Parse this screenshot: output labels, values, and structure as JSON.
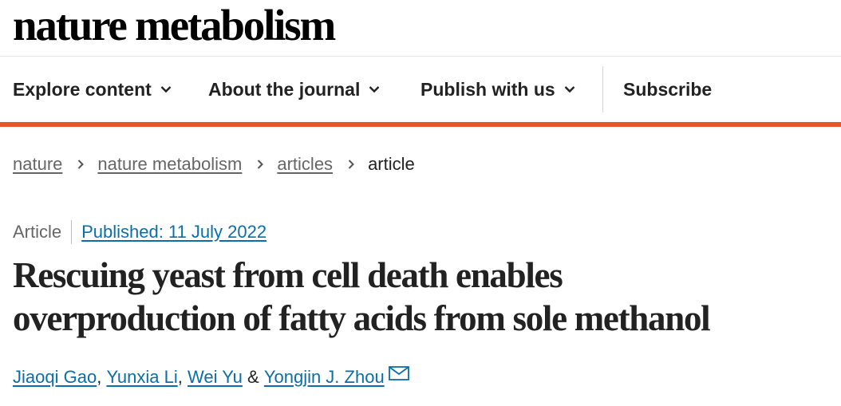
{
  "header": {
    "logo_text": "nature metabolism"
  },
  "nav": {
    "items": [
      {
        "label": "Explore content",
        "has_dropdown": true
      },
      {
        "label": "About the journal",
        "has_dropdown": true
      },
      {
        "label": "Publish with us",
        "has_dropdown": true
      },
      {
        "label": "Subscribe",
        "has_dropdown": false
      }
    ],
    "accent_color": "#e8552b"
  },
  "breadcrumb": {
    "items": [
      "nature",
      "nature metabolism",
      "articles"
    ],
    "current": "article"
  },
  "article": {
    "type": "Article",
    "published": "Published: 11 July 2022",
    "title_line1": "Rescuing yeast from cell death enables",
    "title_line2": "overproduction of fatty acids from sole methanol",
    "authors": [
      "Jiaoqi Gao",
      "Yunxia Li",
      "Wei Yu",
      "Yongjin J. Zhou"
    ],
    "author_separators": [
      ",",
      ",",
      "&"
    ],
    "link_color": "#0a6ea8",
    "corresponding_icon": "mail-icon"
  }
}
